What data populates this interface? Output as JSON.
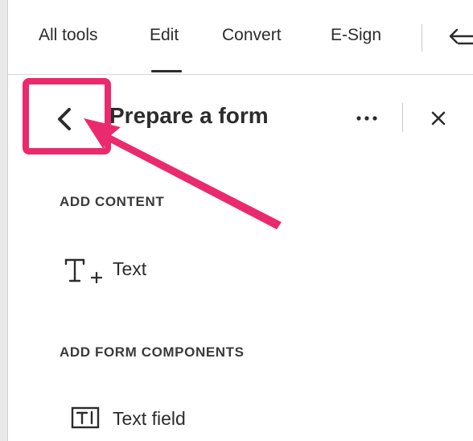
{
  "topnav": {
    "tabs": [
      {
        "label": "All tools"
      },
      {
        "label": "Edit"
      },
      {
        "label": "Convert"
      },
      {
        "label": "E-Sign"
      }
    ],
    "active_tab": "Edit",
    "undo_icon": "undo-icon"
  },
  "panel": {
    "title": "Prepare a form",
    "back_icon": "chevron-left-icon",
    "more_icon": "more-horizontal-icon",
    "close_icon": "close-icon"
  },
  "sections": [
    {
      "heading": "ADD CONTENT",
      "items": [
        {
          "label": "Text",
          "icon": "add-text-icon"
        }
      ]
    },
    {
      "heading": "ADD FORM COMPONENTS",
      "items": [
        {
          "label": "Text field",
          "icon": "text-field-icon"
        }
      ]
    }
  ],
  "colors": {
    "annotation": "#ea2a6d",
    "text": "#2c2c2c"
  }
}
